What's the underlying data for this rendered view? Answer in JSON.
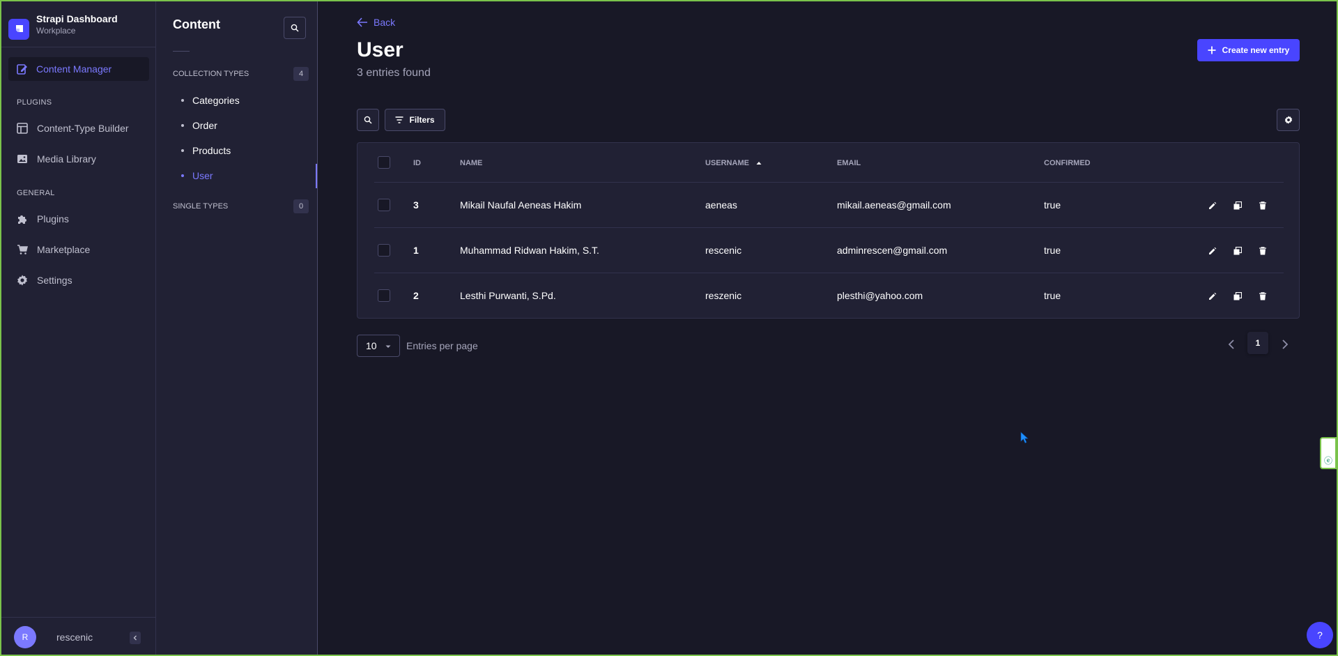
{
  "brand": {
    "title": "Strapi Dashboard",
    "subtitle": "Workplace"
  },
  "mainnav": {
    "active": "Content Manager",
    "plugins_label": "PLUGINS",
    "plugins": [
      "Content-Type Builder",
      "Media Library"
    ],
    "general_label": "GENERAL",
    "general": [
      "Plugins",
      "Marketplace",
      "Settings"
    ],
    "user_initial": "R",
    "username": "rescenic"
  },
  "subnav": {
    "title": "Content",
    "collection_label": "COLLECTION TYPES",
    "collection_count": "4",
    "collections": [
      "Categories",
      "Order",
      "Products",
      "User"
    ],
    "active_collection": "User",
    "single_label": "SINGLE TYPES",
    "single_count": "0"
  },
  "header": {
    "back_label": "Back",
    "title": "User",
    "subtitle": "3 entries found",
    "create_label": "Create new entry"
  },
  "toolbar": {
    "filters_label": "Filters"
  },
  "table": {
    "columns": [
      "ID",
      "NAME",
      "USERNAME",
      "EMAIL",
      "CONFIRMED"
    ],
    "sorted_column": "USERNAME",
    "rows": [
      {
        "id": "3",
        "name": "Mikail Naufal Aeneas Hakim",
        "username": "aeneas",
        "email": "mikail.aeneas@gmail.com",
        "confirmed": "true"
      },
      {
        "id": "1",
        "name": "Muhammad Ridwan Hakim, S.T.",
        "username": "rescenic",
        "email": "adminrescen@gmail.com",
        "confirmed": "true"
      },
      {
        "id": "2",
        "name": "Lesthi Purwanti, S.Pd.",
        "username": "reszenic",
        "email": "plesthi@yahoo.com",
        "confirmed": "true"
      }
    ]
  },
  "pagination": {
    "per_page": "10",
    "per_page_label": "Entries per page",
    "current_page": "1"
  },
  "widgets": {
    "help": "?"
  },
  "colors": {
    "accent": "#4945ff",
    "active_text": "#7b79ff",
    "background": "#181826",
    "panel": "#212134"
  }
}
